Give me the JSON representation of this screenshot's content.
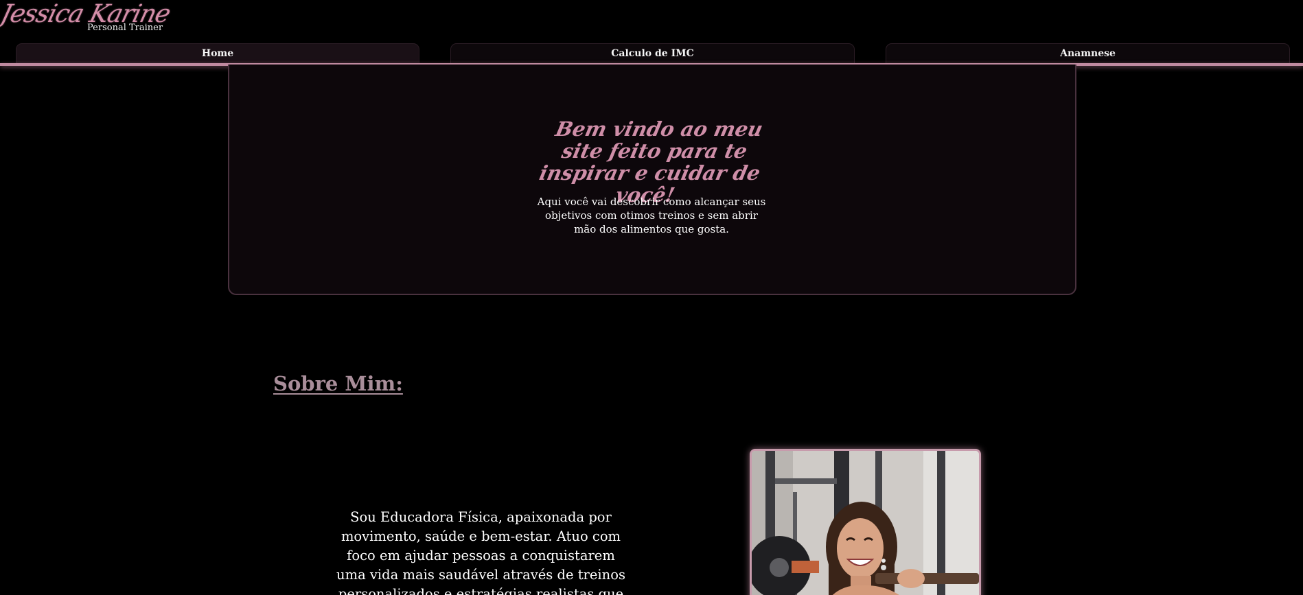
{
  "brand": {
    "name": "Jessica Karine",
    "subtitle": "Personal Trainer"
  },
  "nav": {
    "tabs": [
      {
        "label": "Home",
        "active": true
      },
      {
        "label": "Calculo de IMC",
        "active": false
      },
      {
        "label": "Anamnese",
        "active": false
      }
    ]
  },
  "hero": {
    "title": "Bem vindo ao meu site feito para te inspirar e cuidar de você!",
    "description": "Aqui você vai descobrir como alcançar seus objetivos com otimos treinos e sem abrir mão dos alimentos que gosta."
  },
  "about": {
    "heading": "Sobre Mim:",
    "text": "Sou Educadora Física, apaixonada por movimento, saúde e bem-estar. Atuo com foco em ajudar pessoas a conquistarem uma vida mais saudável através de treinos personalizados e estratégias realistas que se"
  },
  "colors": {
    "background": "#000000",
    "accent": "#c08aa0",
    "script_pink": "#cf8ea8",
    "hero_panel": "#0d070b"
  }
}
